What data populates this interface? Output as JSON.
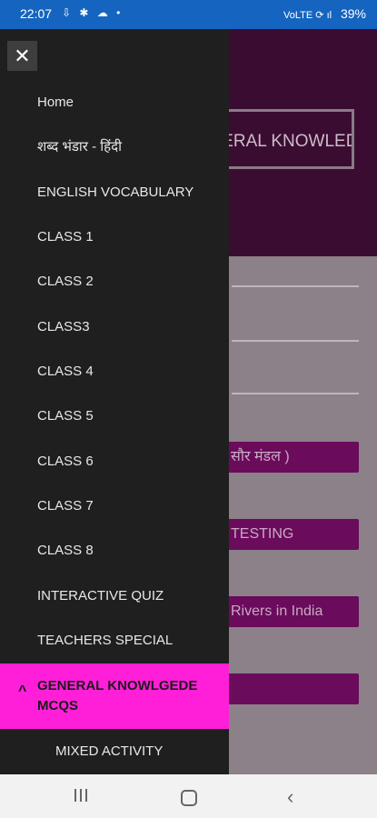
{
  "status_bar": {
    "time": "22:07",
    "notification_icons": "⇩ ✱ ☁ •",
    "signal": "VoLTE ⟳ ıl",
    "battery": "39%"
  },
  "background": {
    "hero_button": "GENERAL KNOWLEDGE MCQS",
    "buttons": [
      "सौर मंडल )",
      "TESTING",
      "Rivers in India",
      ""
    ]
  },
  "drawer": {
    "close_icon": "✕",
    "items": [
      {
        "label": "Home"
      },
      {
        "label": "शब्द भंडार - हिंदी"
      },
      {
        "label": "ENGLISH VOCABULARY"
      },
      {
        "label": "CLASS 1"
      },
      {
        "label": "CLASS 2"
      },
      {
        "label": "CLASS3"
      },
      {
        "label": "CLASS 4"
      },
      {
        "label": "CLASS 5"
      },
      {
        "label": "CLASS 6"
      },
      {
        "label": "CLASS 7"
      },
      {
        "label": "CLASS 8"
      },
      {
        "label": "INTERACTIVE QUIZ"
      },
      {
        "label": "TEACHERS SPECIAL"
      }
    ],
    "active_item": {
      "label": "GENERAL KNOWLGEDE MCQS",
      "caret": "^"
    },
    "sub_items": [
      {
        "label": "MIXED ACTIVITY"
      }
    ]
  },
  "nav_bar": {
    "back_icon": "‹"
  }
}
